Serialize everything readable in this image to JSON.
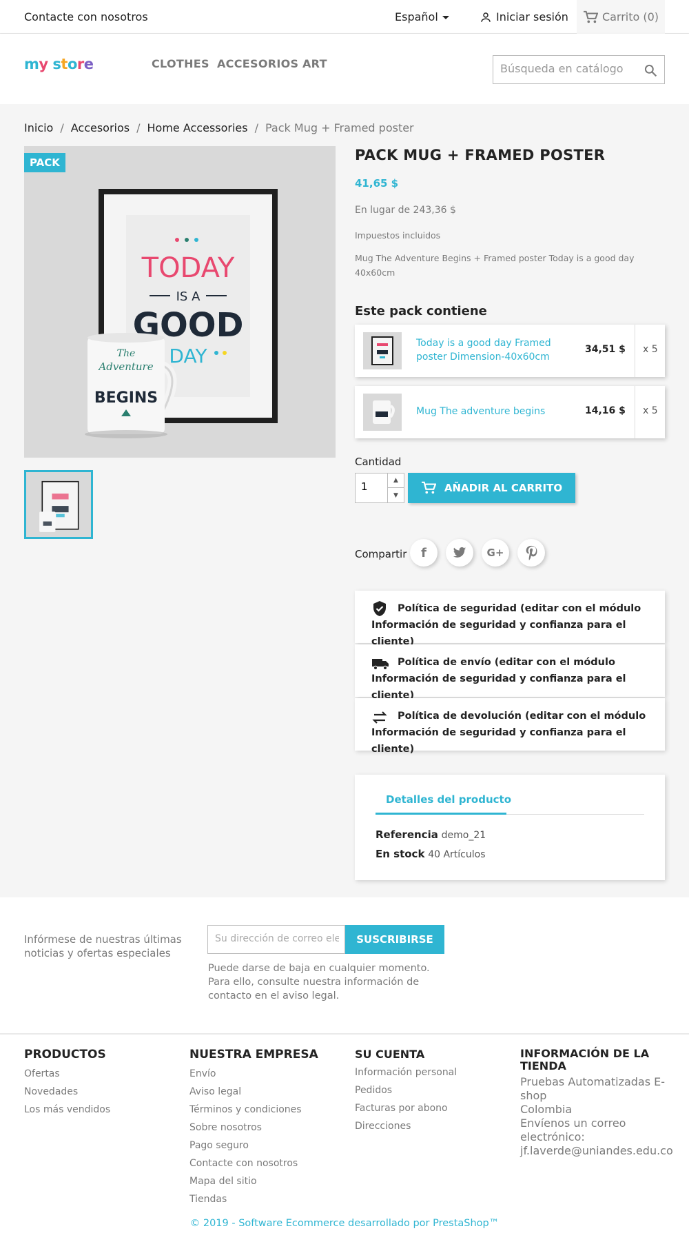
{
  "topnav": {
    "contact": "Contacte con nosotros",
    "language": "Español",
    "signin": "Iniciar sesión",
    "cart": "Carrito (0)"
  },
  "header": {
    "logo": "my store",
    "nav": [
      "CLOTHES",
      "ACCESORIOS",
      "ART"
    ],
    "search_placeholder": "Búsqueda en catálogo"
  },
  "breadcrumb": [
    "Inicio",
    "Accesorios",
    "Home Accessories",
    "Pack Mug + Framed poster"
  ],
  "product": {
    "badge": "PACK",
    "title": "PACK MUG + FRAMED POSTER",
    "price": "41,65 $",
    "old_price": "En lugar de 243,36 $",
    "tax": "Impuestos incluidos",
    "description": "Mug The Adventure Begins + Framed poster Today is a good day 40x60cm",
    "poster_words": [
      "TODAY",
      "IS A",
      "GOOD",
      "DAY"
    ],
    "mug_words": [
      "The",
      "Adventure",
      "BEGINS"
    ]
  },
  "pack": {
    "title": "Este pack contiene",
    "items": [
      {
        "name": "Today is a good day Framed poster Dimension-40x60cm",
        "price": "34,51 $",
        "qty": "x 5"
      },
      {
        "name": "Mug The adventure begins",
        "price": "14,16 $",
        "qty": "x 5"
      }
    ]
  },
  "buy": {
    "qty_label": "Cantidad",
    "qty_value": "1",
    "add_to_cart": "AÑADIR AL CARRITO"
  },
  "share": {
    "label": "Compartir",
    "icons": [
      "facebook-icon",
      "twitter-icon",
      "google-plus-icon",
      "pinterest-icon"
    ]
  },
  "reassurance": [
    {
      "icon": "shield-icon",
      "text": "Política de seguridad (editar con el módulo Información de seguridad y confianza para el cliente)"
    },
    {
      "icon": "truck-icon",
      "text": "Política de envío (editar con el módulo Información de seguridad y confianza para el cliente)"
    },
    {
      "icon": "swap-arrows-icon",
      "text": "Política de devolución (editar con el módulo Información de seguridad y confianza para el cliente)"
    }
  ],
  "details": {
    "tab": "Detalles del producto",
    "reference_label": "Referencia",
    "reference_value": "demo_21",
    "stock_label": "En stock",
    "stock_value": "40 Artículos"
  },
  "newsletter": {
    "text": "Infórmese de nuestras últimas noticias y ofertas especiales",
    "placeholder": "Su dirección de correo electrónico",
    "button": "SUSCRIBIRSE",
    "note": "Puede darse de baja en cualquier momento. Para ello, consulte nuestra información de contacto en el aviso legal."
  },
  "footer": {
    "products": {
      "title": "PRODUCTOS",
      "links": [
        "Ofertas",
        "Novedades",
        "Los más vendidos"
      ]
    },
    "company": {
      "title": "NUESTRA EMPRESA",
      "links": [
        "Envío",
        "Aviso legal",
        "Términos y condiciones",
        "Sobre nosotros",
        "Pago seguro",
        "Contacte con nosotros",
        "Mapa del sitio",
        "Tiendas"
      ]
    },
    "account": {
      "title": "SU CUENTA",
      "links": [
        "Información personal",
        "Pedidos",
        "Facturas por abono",
        "Direcciones"
      ]
    },
    "store": {
      "title": "INFORMACIÓN DE LA TIENDA",
      "lines": [
        "Pruebas Automatizadas E-shop",
        "Colombia",
        "Envíenos un correo electrónico:",
        "jf.laverde@uniandes.edu.co"
      ]
    },
    "copyright": "© 2019 - Software Ecommerce desarrollado por PrestaShop™"
  },
  "colors": {
    "accent": "#2fb5d2",
    "text": "#232323",
    "muted": "#7a7a7a",
    "poster_pink": "#e8486f",
    "mug_green": "#2a7f6f"
  }
}
